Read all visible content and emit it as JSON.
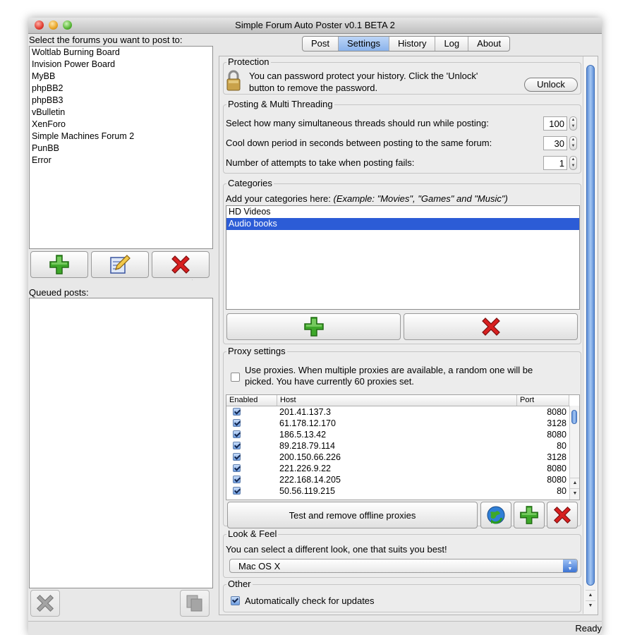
{
  "window": {
    "title": "Simple Forum Auto Poster v0.1 BETA 2"
  },
  "left": {
    "forums_label": "Select the forums you want to post to:",
    "forums": [
      "Woltlab Burning Board",
      "Invision Power Board",
      "MyBB",
      "phpBB2",
      "phpBB3",
      "vBulletin",
      "XenForo",
      "Simple Machines Forum 2",
      "PunBB",
      "Error"
    ],
    "buttons": {
      "add": "plus-icon",
      "edit": "edit-icon",
      "remove": "x-icon"
    },
    "queued_label": "Queued posts:",
    "bottom_buttons": {
      "remove": "x-icon",
      "duplicate": "copy-icon"
    }
  },
  "tabs": [
    {
      "label": "Post",
      "active": false
    },
    {
      "label": "Settings",
      "active": true
    },
    {
      "label": "History",
      "active": false
    },
    {
      "label": "Log",
      "active": false
    },
    {
      "label": "About",
      "active": false
    }
  ],
  "protection": {
    "title": "Protection",
    "line1": "You can password protect your history. Click the 'Unlock'",
    "line2": "button to remove the password.",
    "unlock_label": "Unlock"
  },
  "threading": {
    "title": "Posting & Multi Threading",
    "threads_label": "Select how many simultaneous threads should run while posting:",
    "threads_value": "100",
    "cooldown_label": "Cool down period in seconds between posting to the same forum:",
    "cooldown_value": "30",
    "attempts_label": "Number of attempts to take when posting fails:",
    "attempts_value": "1"
  },
  "categories": {
    "title": "Categories",
    "hint_prefix": "Add your categories here: ",
    "hint_example": "(Example: \"Movies\", \"Games\" and \"Music\")",
    "items": [
      {
        "label": "HD Videos",
        "selected": false
      },
      {
        "label": "Audio books",
        "selected": true
      }
    ]
  },
  "proxy": {
    "title": "Proxy settings",
    "use_line1": "Use proxies. When multiple proxies are available, a random one will be",
    "use_line2": "picked. You have currently 60 proxies set.",
    "use_checked": false,
    "columns": {
      "enabled": "Enabled",
      "host": "Host",
      "port": "Port"
    },
    "rows": [
      {
        "host": "201.41.137.3",
        "port": "8080"
      },
      {
        "host": "61.178.12.170",
        "port": "3128"
      },
      {
        "host": "186.5.13.42",
        "port": "8080"
      },
      {
        "host": "89.218.79.114",
        "port": "80"
      },
      {
        "host": "200.150.66.226",
        "port": "3128"
      },
      {
        "host": "221.226.9.22",
        "port": "8080"
      },
      {
        "host": "222.168.14.205",
        "port": "8080"
      },
      {
        "host": "50.56.119.215",
        "port": "80"
      }
    ],
    "test_label": "Test and remove offline proxies"
  },
  "look": {
    "title": "Look & Feel",
    "hint": "You can select a different look, one that suits you best!",
    "selected": "Mac OS X"
  },
  "other": {
    "title": "Other",
    "updates_label": "Automatically check for updates",
    "updates_checked": true
  },
  "status": {
    "text": "Ready"
  },
  "colors": {
    "selection": "#2c5cd6",
    "active_tab": "#8ab3eb",
    "plus_green": "#3ea82a",
    "x_red": "#d82020"
  }
}
